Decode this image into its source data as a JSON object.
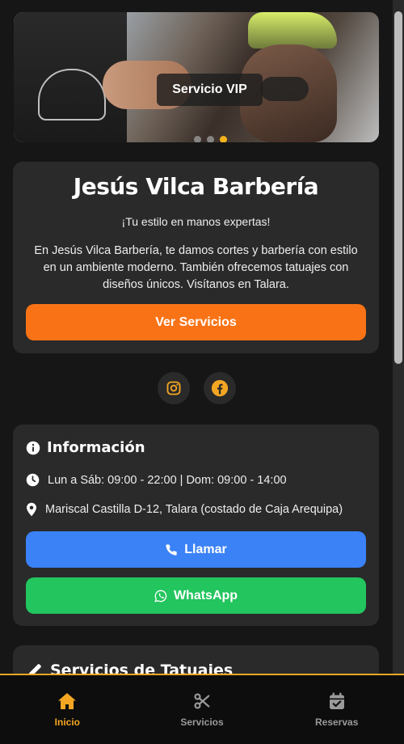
{
  "hero": {
    "label": "Servicio VIP",
    "dots": [
      false,
      false,
      true
    ]
  },
  "intro": {
    "title": "Jesús Vilca Barbería",
    "tagline": "¡Tu estilo en manos expertas!",
    "description": "En Jesús Vilca Barbería, te damos cortes y barbería con estilo en un ambiente moderno. También ofrecemos tatuajes con diseños únicos. Visítanos en Talara.",
    "services_button": "Ver Servicios"
  },
  "socials": [
    {
      "icon": "instagram-icon"
    },
    {
      "icon": "facebook-icon"
    }
  ],
  "info": {
    "title": "Información",
    "hours": "Lun a Sáb: 09:00 - 22:00 | Dom: 09:00 - 14:00",
    "address": "Mariscal Castilla D-12, Talara (costado de Caja Arequipa)",
    "call_button": "Llamar",
    "whatsapp_button": "WhatsApp"
  },
  "tattoo": {
    "title": "Servicios de Tatuajes"
  },
  "nav": {
    "items": [
      {
        "label": "Inicio",
        "icon": "home-icon",
        "active": true
      },
      {
        "label": "Servicios",
        "icon": "scissors-icon",
        "active": false
      },
      {
        "label": "Reservas",
        "icon": "calendar-check-icon",
        "active": false
      }
    ]
  },
  "colors": {
    "accent": "#f4a623",
    "orange_button": "#f97316",
    "call_button": "#3b82f6",
    "whatsapp_button": "#22c55e",
    "card": "#2a2a2a",
    "background": "#161616"
  }
}
